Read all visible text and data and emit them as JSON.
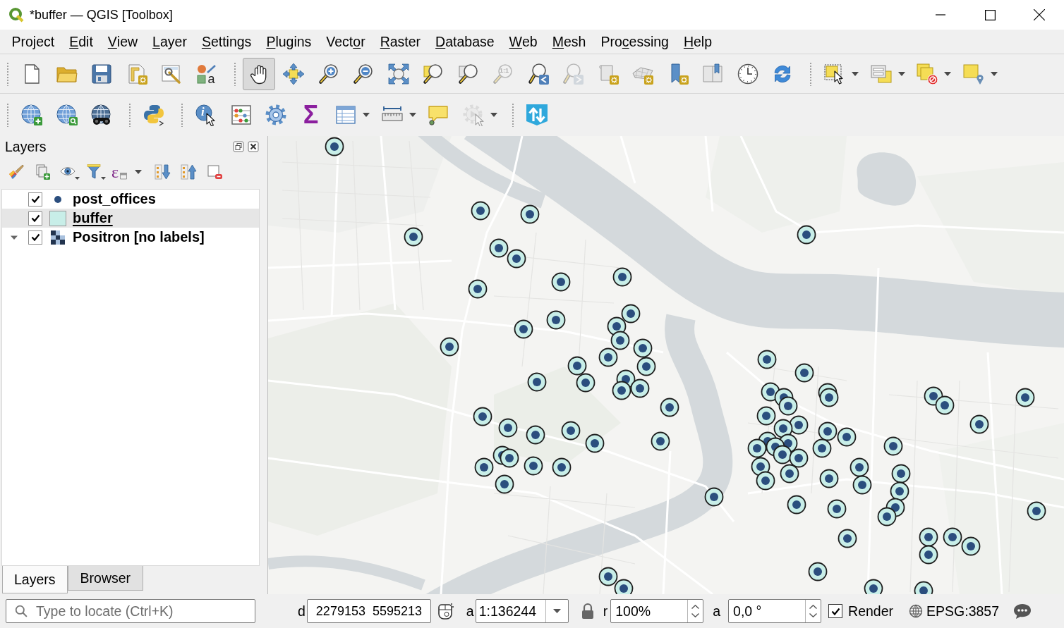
{
  "window": {
    "title": "*buffer — QGIS [Toolbox]"
  },
  "menu_bar": [
    {
      "text": "Project"
    },
    {
      "key": "E",
      "text_after": "dit"
    },
    {
      "key": "V",
      "text_after": "iew"
    },
    {
      "key": "L",
      "text_after": "ayer"
    },
    {
      "key": "S",
      "text_after": "ettings"
    },
    {
      "key": "P",
      "text_after": "lugins"
    },
    {
      "text": "Vect",
      "key": "o",
      "text_after": "r"
    },
    {
      "key": "R",
      "text_after": "aster"
    },
    {
      "key": "D",
      "text_after": "atabase"
    },
    {
      "key": "W",
      "text_after": "eb"
    },
    {
      "key": "M",
      "text_after": "esh"
    },
    {
      "text": "Pro",
      "key": "c",
      "text_after": "essing"
    },
    {
      "key": "H",
      "text_after": "elp"
    }
  ],
  "toolbars": [
    {
      "groups": [
        {
          "buttons": [
            {
              "selected": false,
              "disabled": false,
              "menu": false
            },
            {
              "selected": false,
              "disabled": false,
              "menu": false
            },
            {
              "selected": false,
              "disabled": false,
              "menu": false
            },
            {
              "selected": false,
              "disabled": false,
              "menu": false
            },
            {
              "selected": false,
              "disabled": false,
              "menu": false
            },
            {
              "glyph": "a",
              "selected": false,
              "disabled": false,
              "menu": false
            }
          ]
        },
        {
          "buttons": [
            {
              "selected": true,
              "disabled": false,
              "menu": false
            },
            {
              "selected": false,
              "disabled": false,
              "menu": false
            },
            {
              "selected": false,
              "disabled": false,
              "menu": false
            },
            {
              "selected": false,
              "disabled": false,
              "menu": false
            },
            {
              "selected": false,
              "disabled": false,
              "menu": false
            },
            {
              "selected": false,
              "disabled": false,
              "menu": false
            },
            {
              "selected": false,
              "disabled": false,
              "menu": false
            },
            {
              "glyph": "1:1",
              "selected": false,
              "disabled": true,
              "menu": false
            },
            {
              "selected": false,
              "disabled": false,
              "menu": false
            },
            {
              "selected": false,
              "disabled": true,
              "menu": false
            },
            {
              "selected": false,
              "disabled": false,
              "menu": false
            },
            {
              "selected": false,
              "disabled": false,
              "menu": false
            },
            {
              "selected": false,
              "disabled": false,
              "menu": false
            },
            {
              "selected": false,
              "disabled": false,
              "menu": false
            },
            {
              "selected": false,
              "disabled": false,
              "menu": false
            },
            {
              "selected": false,
              "disabled": false,
              "menu": false
            }
          ]
        },
        {
          "buttons": [
            {
              "selected": false,
              "disabled": false,
              "menu": true
            },
            {
              "selected": false,
              "disabled": false,
              "menu": true
            },
            {
              "selected": false,
              "disabled": false,
              "menu": true
            },
            {
              "selected": false,
              "disabled": false,
              "menu": true
            }
          ]
        }
      ]
    },
    {
      "groups": [
        {
          "buttons": [
            {
              "selected": false,
              "disabled": false,
              "menu": false
            },
            {
              "selected": false,
              "disabled": false,
              "menu": false
            },
            {
              "selected": false,
              "disabled": false,
              "menu": false
            }
          ]
        },
        {
          "buttons": [
            {
              "selected": false,
              "disabled": false,
              "menu": false
            }
          ]
        },
        {
          "buttons": [
            {
              "glyph": "i",
              "selected": false,
              "disabled": false,
              "menu": false
            },
            {
              "selected": false,
              "disabled": false,
              "menu": false
            },
            {
              "selected": false,
              "disabled": false,
              "menu": false
            },
            {
              "glyph": "Σ",
              "selected": false,
              "disabled": false,
              "menu": false
            },
            {
              "selected": false,
              "disabled": false,
              "menu": true
            },
            {
              "selected": false,
              "disabled": false,
              "menu": true
            },
            {
              "selected": false,
              "disabled": false,
              "menu": false
            },
            {
              "selected": false,
              "disabled": true,
              "menu": true
            }
          ]
        },
        {
          "buttons": [
            {
              "selected": false,
              "disabled": false,
              "menu": false
            }
          ]
        }
      ]
    }
  ],
  "layers_panel": {
    "title": "Layers",
    "toolbar": [
      {
        "kind": "plain"
      },
      {
        "kind": "plain"
      },
      {
        "kind": "corner_menu"
      },
      {
        "kind": "corner_menu"
      },
      {
        "kind": "side_menu",
        "glyph": "ε"
      },
      {
        "kind": "plain"
      },
      {
        "kind": "plain"
      },
      {
        "kind": "plain"
      }
    ],
    "layers": [
      {
        "name": "post_offices",
        "kind": "point",
        "color": "#2b4e7e",
        "checked": true,
        "selected": false
      },
      {
        "name": "buffer",
        "kind": "polygon",
        "color": "#c8eee8",
        "checked": true,
        "selected": true
      },
      {
        "name": "Positron [no labels]",
        "kind": "raster",
        "checked": true,
        "selected": false,
        "expanded": true
      }
    ]
  },
  "panel_tabs": [
    {
      "label": "Layers",
      "selected": true
    },
    {
      "label": "Browser",
      "selected": false
    }
  ],
  "status_bar": {
    "locator": {
      "placeholder": "Type to locate (Ctrl+K)"
    },
    "coordinate_label": "d",
    "coordinate": "2279153  5595213",
    "scale_label": "a",
    "scale": "1:136244",
    "magnifier_label": "r",
    "magnifier": "100%",
    "rotation_label": "a",
    "rotation": "0,0 °",
    "render": {
      "label": "Render",
      "checked": true
    },
    "crs": "EPSG:3857"
  }
}
